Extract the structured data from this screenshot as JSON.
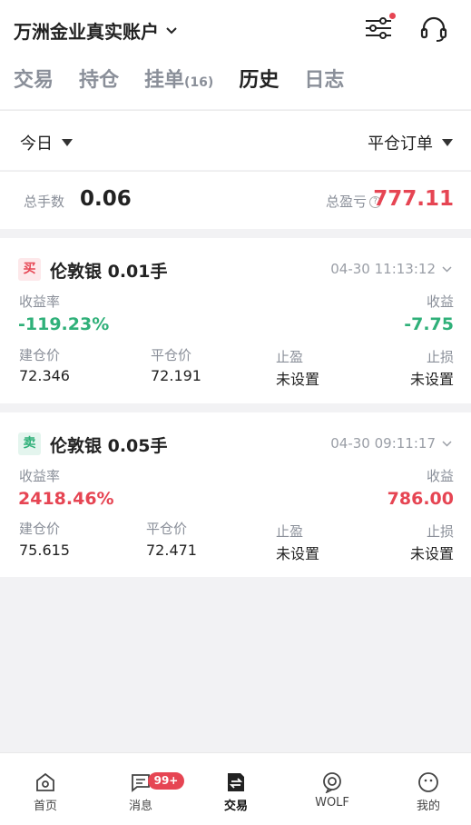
{
  "header": {
    "account_title": "万洲金业真实账户",
    "icons": [
      "chevron-down-icon",
      "filter-settings-icon",
      "customer-service-icon"
    ]
  },
  "tabs": [
    {
      "label": "交易",
      "count": ""
    },
    {
      "label": "持仓",
      "count": ""
    },
    {
      "label": "挂单",
      "count": "(16)"
    },
    {
      "label": "历史",
      "count": ""
    },
    {
      "label": "日志",
      "count": ""
    }
  ],
  "active_tab": "历史",
  "filters": {
    "period": "今日",
    "order_type": "平仓订单"
  },
  "summary": {
    "total_lots_label": "总手数",
    "total_lots_value": "0.06",
    "total_pnl_label": "总盈亏",
    "total_pnl_value": "777.11"
  },
  "orders": [
    {
      "side": "买",
      "product": "伦敦银 0.01手",
      "time": "04-30 11:13:12",
      "yield_label": "收益率",
      "yield_value": "-119.23%",
      "profit_label": "收益",
      "profit_value": "-7.75",
      "open_label": "建仓价",
      "open_value": "72.346",
      "close_label": "平仓价",
      "close_value": "72.191",
      "tp_label": "止盈",
      "tp_value": "未设置",
      "sl_label": "止损",
      "sl_value": "未设置"
    },
    {
      "side": "卖",
      "product": "伦敦银 0.05手",
      "time": "04-30 09:11:17",
      "yield_label": "收益率",
      "yield_value": "2418.46%",
      "profit_label": "收益",
      "profit_value": "786.00",
      "open_label": "建仓价",
      "open_value": "75.615",
      "close_label": "平仓价",
      "close_value": "72.471",
      "tp_label": "止盈",
      "tp_value": "未设置",
      "sl_label": "止损",
      "sl_value": "未设置"
    }
  ],
  "nav": {
    "items": [
      {
        "label": "首页",
        "icon": "home-icon"
      },
      {
        "label": "消息",
        "icon": "message-icon"
      },
      {
        "label": "交易",
        "icon": "trade-icon"
      },
      {
        "label": "WOLF",
        "icon": "wolf-icon"
      },
      {
        "label": "我的",
        "icon": "profile-icon"
      }
    ],
    "message_badge": "99+"
  },
  "colors": {
    "up": "#e64553",
    "down": "#2fb079"
  }
}
